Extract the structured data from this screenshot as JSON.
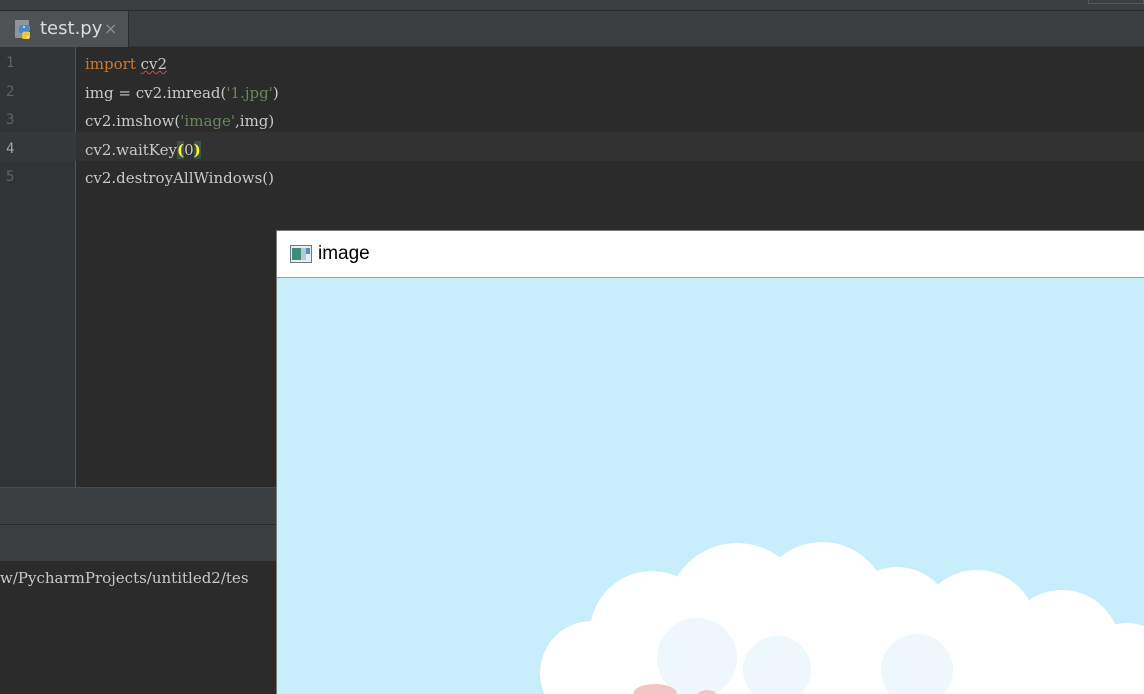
{
  "editor_tab": {
    "filename": "test.py",
    "close_glyph": "×",
    "icon": "python-file-icon"
  },
  "code": {
    "line_numbers": [
      "1",
      "2",
      "3",
      "4",
      "5"
    ],
    "active_line": 4,
    "lines": [
      [
        {
          "t": "import",
          "c": "kw"
        },
        {
          "t": " "
        },
        {
          "t": "cv2",
          "c": "squiggle"
        }
      ],
      [
        {
          "t": "img = cv2.imread("
        },
        {
          "t": "'1.jpg'",
          "c": "str"
        },
        {
          "t": ")"
        }
      ],
      [
        {
          "t": "cv2.imshow("
        },
        {
          "t": "'image'",
          "c": "str"
        },
        {
          "t": ",img)"
        }
      ],
      [
        {
          "t": "cv2.waitKey"
        },
        {
          "t": "(",
          "c": "bracket"
        },
        {
          "t": "0"
        },
        {
          "t": ")",
          "c": "bracket"
        }
      ],
      [
        {
          "t": "cv2.destroyAllWindows()"
        }
      ]
    ]
  },
  "console": {
    "path_fragment": "w/PycharmProjects/untitled2/tes"
  },
  "image_window": {
    "title": "image",
    "icon": "window-app-icon"
  },
  "colors": {
    "editor_bg": "#2b2b2b",
    "keyword": "#cc7832",
    "string": "#6a8759",
    "sky": "#c8eefb"
  }
}
